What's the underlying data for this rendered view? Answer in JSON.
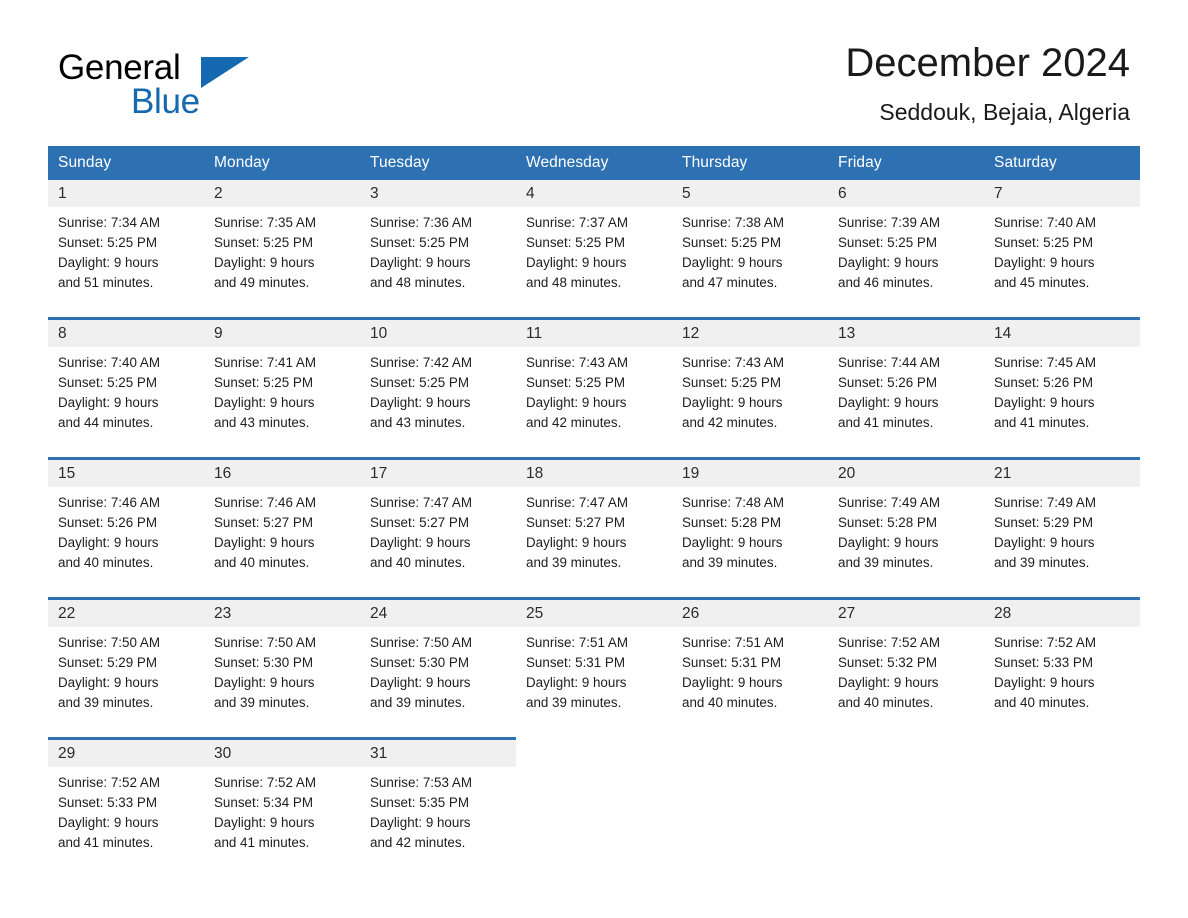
{
  "brand": {
    "name_part1": "General",
    "name_part2": "Blue",
    "logo_color": "#1569b0",
    "triangle_icon": "triangle-icon"
  },
  "header": {
    "title": "December 2024",
    "subtitle": "Seddouk, Bejaia, Algeria"
  },
  "theme": {
    "header_blue": "#2e71b3",
    "daynum_band": "#f0f0f0",
    "text": "#1d1d1d"
  },
  "weekdays": [
    "Sunday",
    "Monday",
    "Tuesday",
    "Wednesday",
    "Thursday",
    "Friday",
    "Saturday"
  ],
  "weeks": [
    {
      "days": [
        {
          "date": "1",
          "sunrise": "Sunrise: 7:34 AM",
          "sunset": "Sunset: 5:25 PM",
          "daylight_1": "Daylight: 9 hours",
          "daylight_2": "and 51 minutes."
        },
        {
          "date": "2",
          "sunrise": "Sunrise: 7:35 AM",
          "sunset": "Sunset: 5:25 PM",
          "daylight_1": "Daylight: 9 hours",
          "daylight_2": "and 49 minutes."
        },
        {
          "date": "3",
          "sunrise": "Sunrise: 7:36 AM",
          "sunset": "Sunset: 5:25 PM",
          "daylight_1": "Daylight: 9 hours",
          "daylight_2": "and 48 minutes."
        },
        {
          "date": "4",
          "sunrise": "Sunrise: 7:37 AM",
          "sunset": "Sunset: 5:25 PM",
          "daylight_1": "Daylight: 9 hours",
          "daylight_2": "and 48 minutes."
        },
        {
          "date": "5",
          "sunrise": "Sunrise: 7:38 AM",
          "sunset": "Sunset: 5:25 PM",
          "daylight_1": "Daylight: 9 hours",
          "daylight_2": "and 47 minutes."
        },
        {
          "date": "6",
          "sunrise": "Sunrise: 7:39 AM",
          "sunset": "Sunset: 5:25 PM",
          "daylight_1": "Daylight: 9 hours",
          "daylight_2": "and 46 minutes."
        },
        {
          "date": "7",
          "sunrise": "Sunrise: 7:40 AM",
          "sunset": "Sunset: 5:25 PM",
          "daylight_1": "Daylight: 9 hours",
          "daylight_2": "and 45 minutes."
        }
      ]
    },
    {
      "days": [
        {
          "date": "8",
          "sunrise": "Sunrise: 7:40 AM",
          "sunset": "Sunset: 5:25 PM",
          "daylight_1": "Daylight: 9 hours",
          "daylight_2": "and 44 minutes."
        },
        {
          "date": "9",
          "sunrise": "Sunrise: 7:41 AM",
          "sunset": "Sunset: 5:25 PM",
          "daylight_1": "Daylight: 9 hours",
          "daylight_2": "and 43 minutes."
        },
        {
          "date": "10",
          "sunrise": "Sunrise: 7:42 AM",
          "sunset": "Sunset: 5:25 PM",
          "daylight_1": "Daylight: 9 hours",
          "daylight_2": "and 43 minutes."
        },
        {
          "date": "11",
          "sunrise": "Sunrise: 7:43 AM",
          "sunset": "Sunset: 5:25 PM",
          "daylight_1": "Daylight: 9 hours",
          "daylight_2": "and 42 minutes."
        },
        {
          "date": "12",
          "sunrise": "Sunrise: 7:43 AM",
          "sunset": "Sunset: 5:25 PM",
          "daylight_1": "Daylight: 9 hours",
          "daylight_2": "and 42 minutes."
        },
        {
          "date": "13",
          "sunrise": "Sunrise: 7:44 AM",
          "sunset": "Sunset: 5:26 PM",
          "daylight_1": "Daylight: 9 hours",
          "daylight_2": "and 41 minutes."
        },
        {
          "date": "14",
          "sunrise": "Sunrise: 7:45 AM",
          "sunset": "Sunset: 5:26 PM",
          "daylight_1": "Daylight: 9 hours",
          "daylight_2": "and 41 minutes."
        }
      ]
    },
    {
      "days": [
        {
          "date": "15",
          "sunrise": "Sunrise: 7:46 AM",
          "sunset": "Sunset: 5:26 PM",
          "daylight_1": "Daylight: 9 hours",
          "daylight_2": "and 40 minutes."
        },
        {
          "date": "16",
          "sunrise": "Sunrise: 7:46 AM",
          "sunset": "Sunset: 5:27 PM",
          "daylight_1": "Daylight: 9 hours",
          "daylight_2": "and 40 minutes."
        },
        {
          "date": "17",
          "sunrise": "Sunrise: 7:47 AM",
          "sunset": "Sunset: 5:27 PM",
          "daylight_1": "Daylight: 9 hours",
          "daylight_2": "and 40 minutes."
        },
        {
          "date": "18",
          "sunrise": "Sunrise: 7:47 AM",
          "sunset": "Sunset: 5:27 PM",
          "daylight_1": "Daylight: 9 hours",
          "daylight_2": "and 39 minutes."
        },
        {
          "date": "19",
          "sunrise": "Sunrise: 7:48 AM",
          "sunset": "Sunset: 5:28 PM",
          "daylight_1": "Daylight: 9 hours",
          "daylight_2": "and 39 minutes."
        },
        {
          "date": "20",
          "sunrise": "Sunrise: 7:49 AM",
          "sunset": "Sunset: 5:28 PM",
          "daylight_1": "Daylight: 9 hours",
          "daylight_2": "and 39 minutes."
        },
        {
          "date": "21",
          "sunrise": "Sunrise: 7:49 AM",
          "sunset": "Sunset: 5:29 PM",
          "daylight_1": "Daylight: 9 hours",
          "daylight_2": "and 39 minutes."
        }
      ]
    },
    {
      "days": [
        {
          "date": "22",
          "sunrise": "Sunrise: 7:50 AM",
          "sunset": "Sunset: 5:29 PM",
          "daylight_1": "Daylight: 9 hours",
          "daylight_2": "and 39 minutes."
        },
        {
          "date": "23",
          "sunrise": "Sunrise: 7:50 AM",
          "sunset": "Sunset: 5:30 PM",
          "daylight_1": "Daylight: 9 hours",
          "daylight_2": "and 39 minutes."
        },
        {
          "date": "24",
          "sunrise": "Sunrise: 7:50 AM",
          "sunset": "Sunset: 5:30 PM",
          "daylight_1": "Daylight: 9 hours",
          "daylight_2": "and 39 minutes."
        },
        {
          "date": "25",
          "sunrise": "Sunrise: 7:51 AM",
          "sunset": "Sunset: 5:31 PM",
          "daylight_1": "Daylight: 9 hours",
          "daylight_2": "and 39 minutes."
        },
        {
          "date": "26",
          "sunrise": "Sunrise: 7:51 AM",
          "sunset": "Sunset: 5:31 PM",
          "daylight_1": "Daylight: 9 hours",
          "daylight_2": "and 40 minutes."
        },
        {
          "date": "27",
          "sunrise": "Sunrise: 7:52 AM",
          "sunset": "Sunset: 5:32 PM",
          "daylight_1": "Daylight: 9 hours",
          "daylight_2": "and 40 minutes."
        },
        {
          "date": "28",
          "sunrise": "Sunrise: 7:52 AM",
          "sunset": "Sunset: 5:33 PM",
          "daylight_1": "Daylight: 9 hours",
          "daylight_2": "and 40 minutes."
        }
      ]
    },
    {
      "days": [
        {
          "date": "29",
          "sunrise": "Sunrise: 7:52 AM",
          "sunset": "Sunset: 5:33 PM",
          "daylight_1": "Daylight: 9 hours",
          "daylight_2": "and 41 minutes."
        },
        {
          "date": "30",
          "sunrise": "Sunrise: 7:52 AM",
          "sunset": "Sunset: 5:34 PM",
          "daylight_1": "Daylight: 9 hours",
          "daylight_2": "and 41 minutes."
        },
        {
          "date": "31",
          "sunrise": "Sunrise: 7:53 AM",
          "sunset": "Sunset: 5:35 PM",
          "daylight_1": "Daylight: 9 hours",
          "daylight_2": "and 42 minutes."
        },
        {
          "date": "",
          "sunrise": "",
          "sunset": "",
          "daylight_1": "",
          "daylight_2": ""
        },
        {
          "date": "",
          "sunrise": "",
          "sunset": "",
          "daylight_1": "",
          "daylight_2": ""
        },
        {
          "date": "",
          "sunrise": "",
          "sunset": "",
          "daylight_1": "",
          "daylight_2": ""
        },
        {
          "date": "",
          "sunrise": "",
          "sunset": "",
          "daylight_1": "",
          "daylight_2": ""
        }
      ]
    }
  ]
}
